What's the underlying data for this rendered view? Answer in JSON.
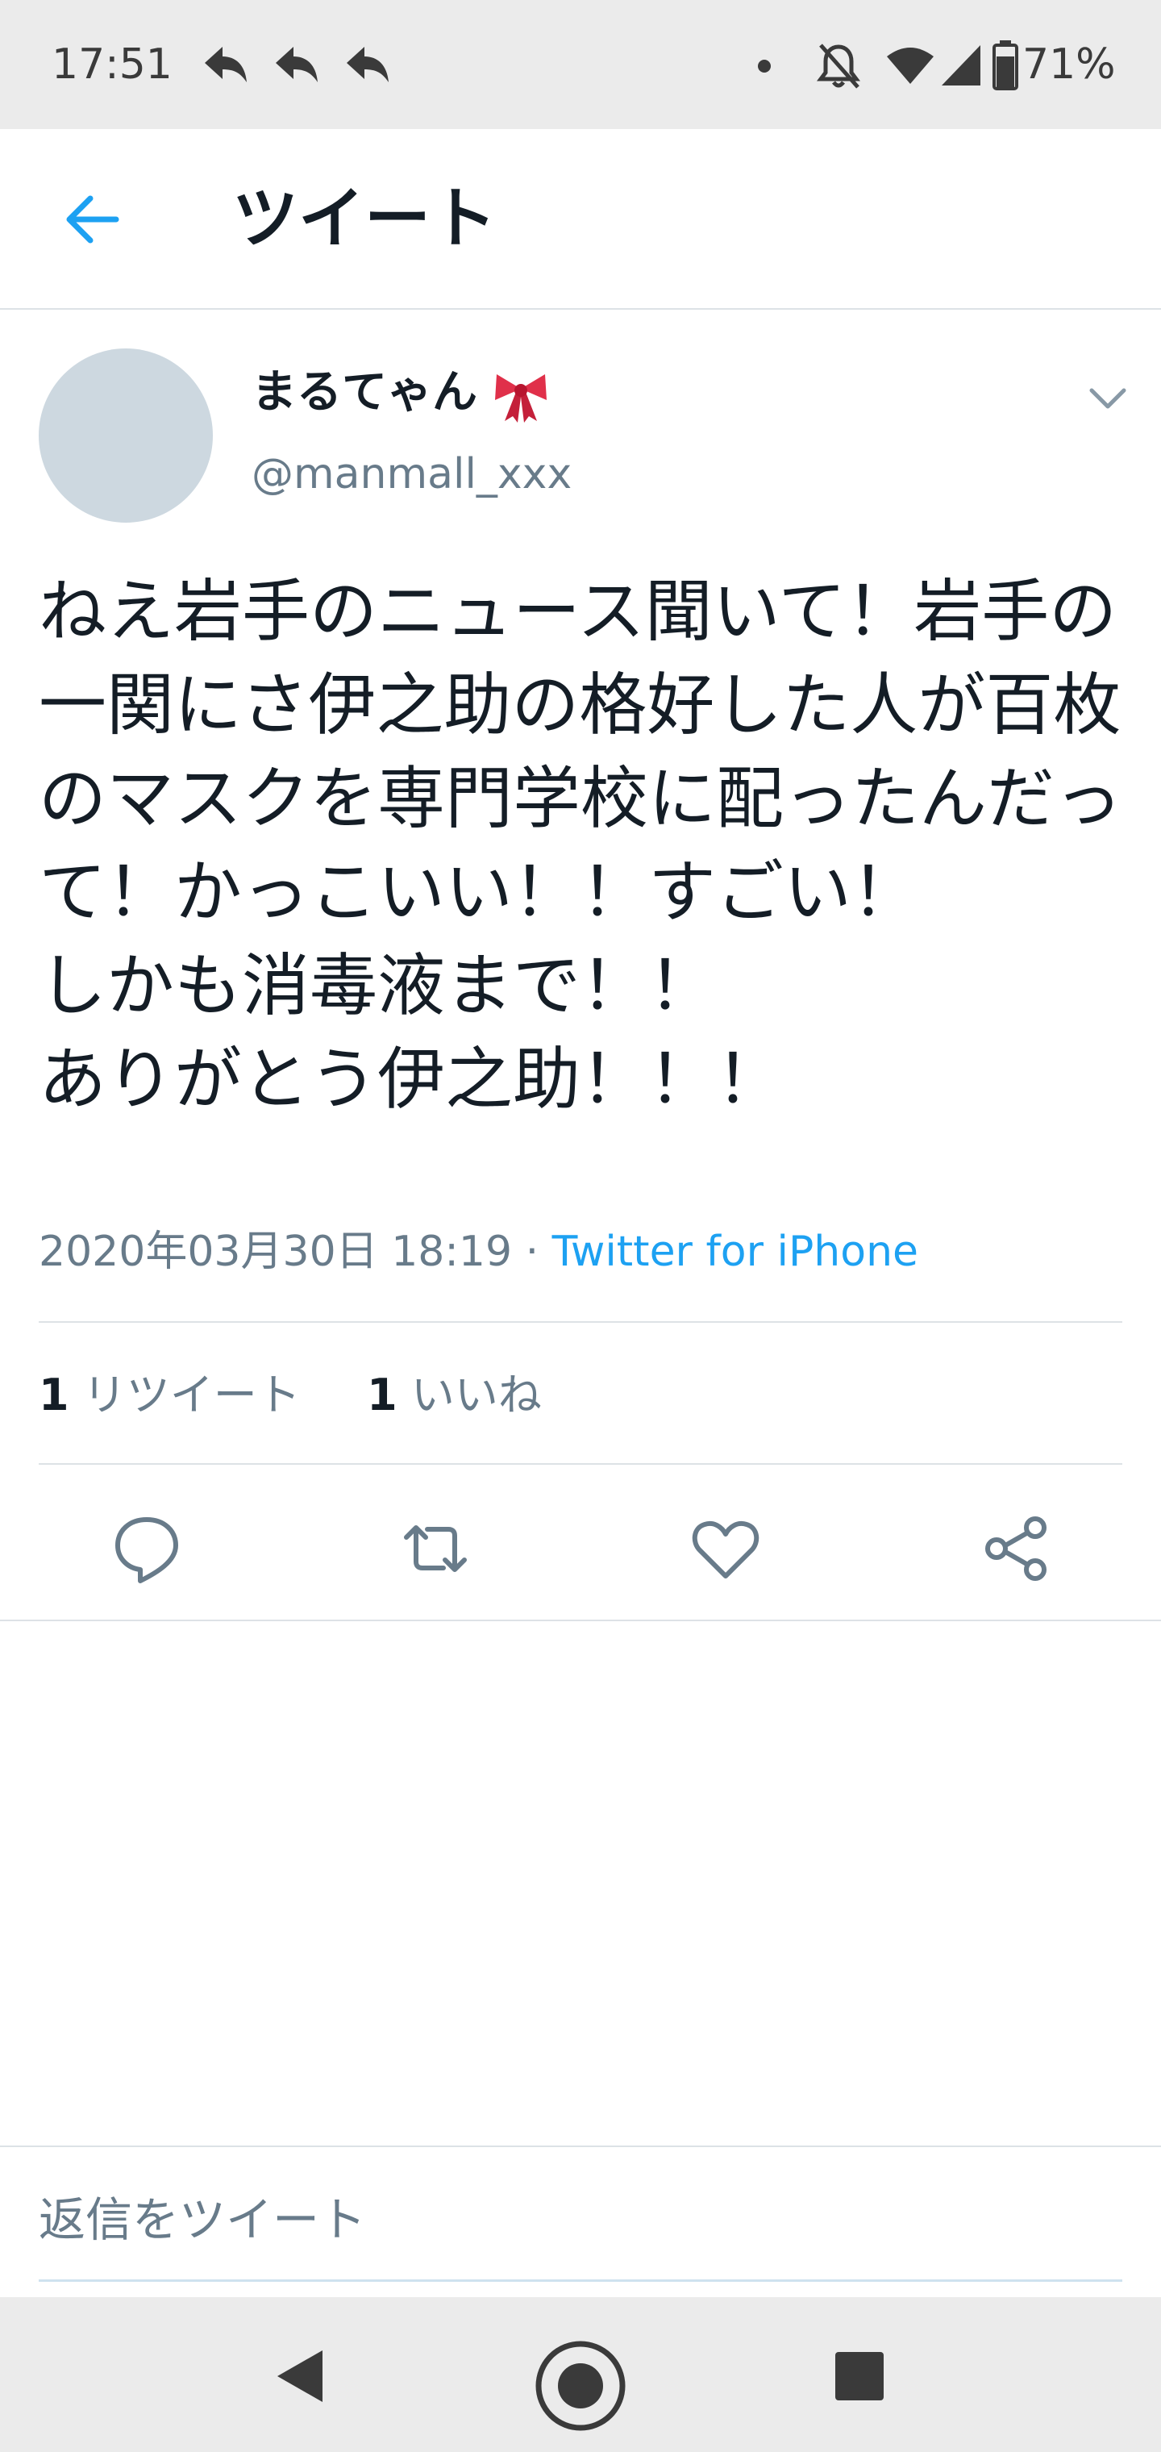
{
  "status_bar": {
    "time": "17:51",
    "battery": "71%",
    "icons": [
      "reply-arrow-icon",
      "reply-arrow-icon",
      "reply-arrow-icon",
      "dot-icon",
      "notifications-off-icon",
      "wifi-icon",
      "signal-icon",
      "battery-icon"
    ]
  },
  "header": {
    "title": "ツイート",
    "back_icon": "arrow-left-icon"
  },
  "tweet": {
    "display_name": "まるてゃん",
    "name_emoji": "ribbon-icon",
    "username": "@manmall_xxx",
    "text": "ねえ岩手のニュース聞いて！岩手の一関にさ伊之助の格好した人が百枚のマスクを専門学校に配ったんだって！かっこいい！！すごい！\nしかも消毒液まで！！\nありがとう伊之助！！！",
    "timestamp": "2020年03月30日 18:19",
    "separator": "·",
    "source": "Twitter for iPhone",
    "retweets": {
      "count": "1",
      "label": "リツイート"
    },
    "likes": {
      "count": "1",
      "label": "いいね"
    }
  },
  "actions": [
    "reply-icon",
    "retweet-icon",
    "like-icon",
    "share-icon"
  ],
  "reply": {
    "placeholder": "返信をツイート"
  },
  "colors": {
    "accent": "#1da1f2",
    "text_primary": "#141d26",
    "text_secondary": "#687b8a",
    "bar_background": "#ebebeb"
  }
}
